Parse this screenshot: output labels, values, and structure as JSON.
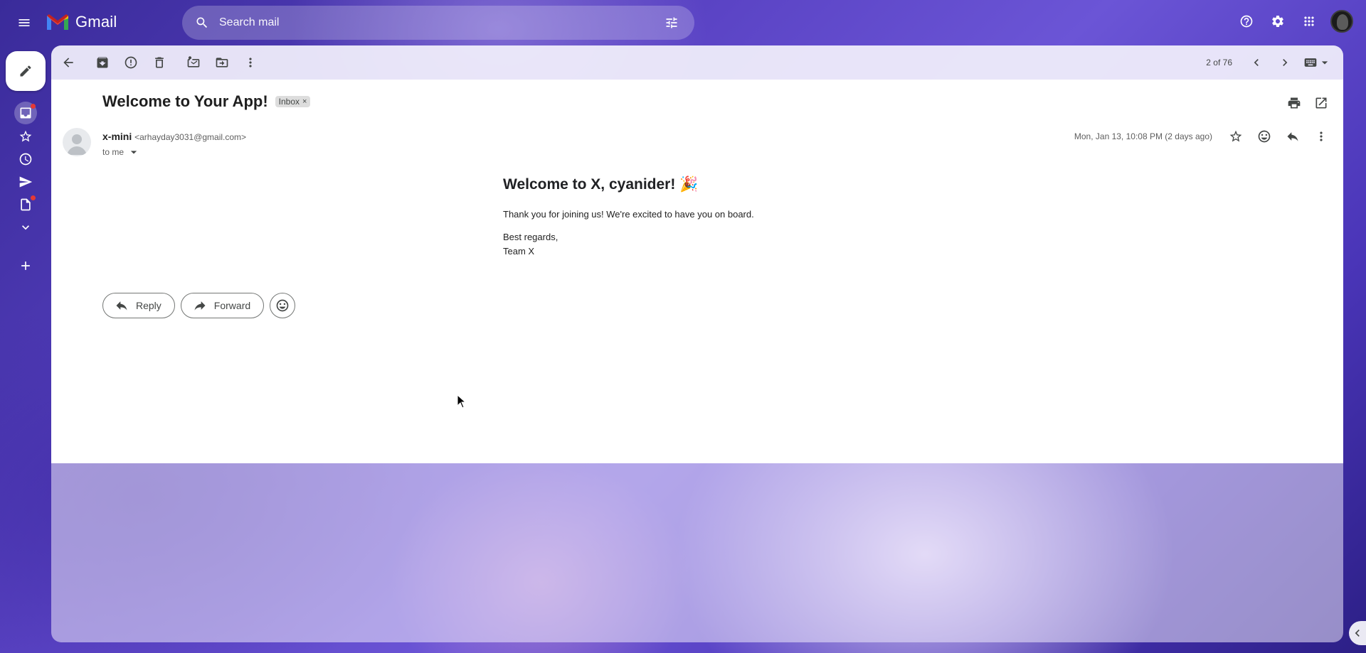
{
  "app": {
    "logo_text": "Gmail"
  },
  "search": {
    "placeholder": "Search mail"
  },
  "toolbar": {
    "pager": "2 of 76",
    "buttons": [
      "back",
      "archive",
      "report-spam",
      "delete",
      "mark-unread",
      "move-to",
      "more"
    ]
  },
  "message": {
    "subject": "Welcome to Your App!",
    "label": "Inbox",
    "label_remove": "×",
    "sender_name": "x-mini",
    "sender_email": "<arhayday3031@gmail.com>",
    "recipient": "to me",
    "date": "Mon, Jan 13, 10:08 PM (2 days ago)",
    "heading": "Welcome to X, cyanider! 🎉",
    "body_line": "Thank you for joining us! We're excited to have you on board.",
    "signoff": "Best regards,",
    "signature": "Team X"
  },
  "actions": {
    "reply": "Reply",
    "forward": "Forward"
  },
  "colors": {
    "accent": "#0b57d0",
    "panel": "#ffffff",
    "toolbar": "#f2f0fc",
    "notification_dot": "#e53935"
  }
}
